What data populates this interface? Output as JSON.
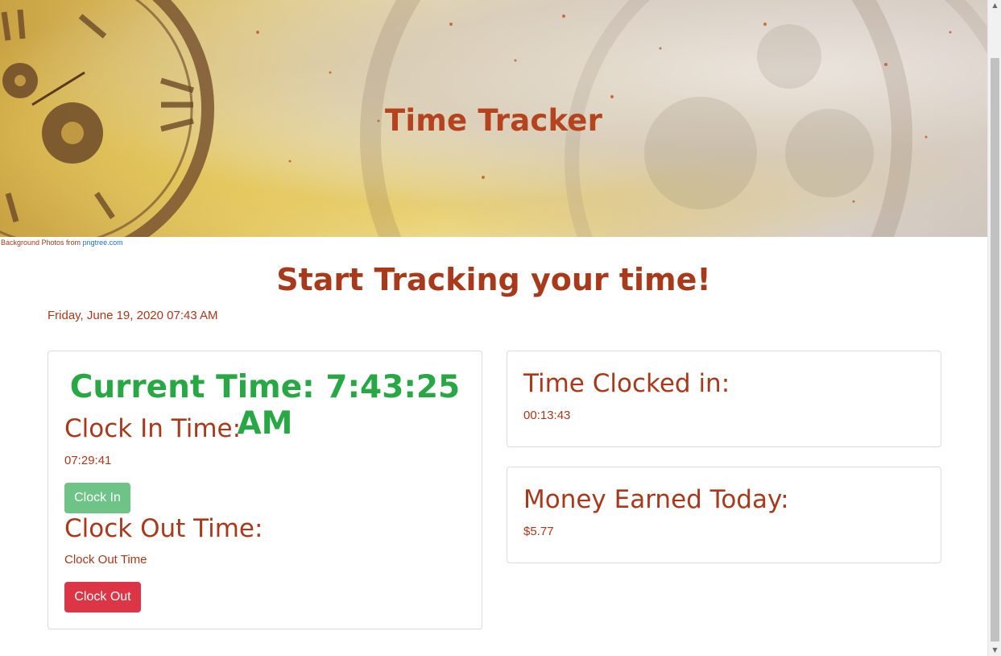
{
  "banner": {
    "title": "Time Tracker",
    "credit_prefix": "Background Photos from ",
    "credit_link": "pngtree.com"
  },
  "main": {
    "heading": "Start Tracking your time!",
    "date": "Friday, June 19, 2020 07:43 AM"
  },
  "clock_card": {
    "current_time": "Current Time: 7:43:25 AM",
    "clock_in_label": "Clock In Time:",
    "clock_in_value": "07:29:41",
    "clock_in_button": "Clock In",
    "clock_out_label": "Clock Out Time:",
    "clock_out_value": "Clock Out Time",
    "clock_out_button": "Clock Out"
  },
  "clocked_card": {
    "label": "Time Clocked in:",
    "value": "00:13:43"
  },
  "money_card": {
    "label": "Money Earned Today:",
    "value": "$5.77"
  },
  "colors": {
    "accent": "#a8391b",
    "current_time": "#28a745",
    "clock_in_button": "#6ec487",
    "clock_out_button": "#dc3545"
  },
  "icons": {
    "scroll_up": "scroll-up-arrow-icon",
    "scroll_down": "scroll-down-arrow-icon"
  }
}
